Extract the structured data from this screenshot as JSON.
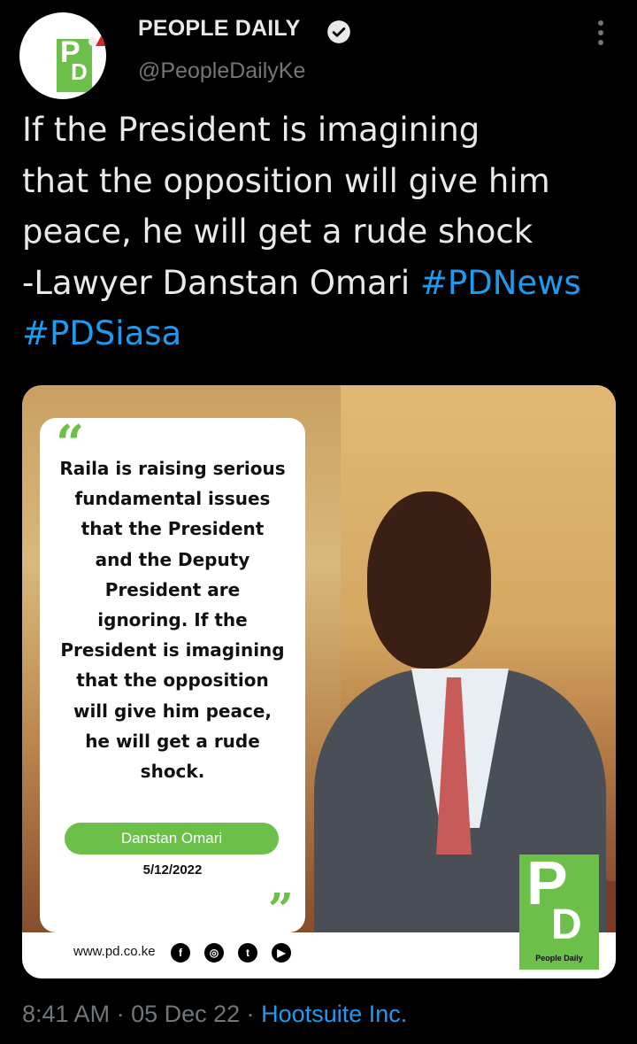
{
  "account": {
    "name": "PEOPLE DAILY",
    "handle": "@PeopleDailyKe",
    "avatar_label": "People Daily"
  },
  "tweet": {
    "lines": [
      "If the President is imagining",
      "that the opposition will give him",
      "peace, he will get a rude shock",
      "-Lawyer Danstan Omari "
    ],
    "hashtag1": "#PDNews",
    "hashtag2": "#PDSiasa"
  },
  "media": {
    "quote_lines": [
      "Raila is raising serious",
      "fundamental issues",
      "that the President",
      "and the Deputy",
      "President are",
      "ignoring. If the",
      "President is imagining",
      "that the opposition",
      "will give him peace,",
      "he will get a rude",
      "shock."
    ],
    "speaker": "Danstan Omari",
    "date": "5/12/2022",
    "website": "www.pd.co.ke",
    "brand": "People Daily",
    "social": [
      "f",
      "◎",
      "t",
      "▶"
    ]
  },
  "meta": {
    "time": "8:41 AM",
    "sep1": " · ",
    "date": "05 Dec 22",
    "sep2": " · ",
    "source": "Hootsuite Inc."
  },
  "colors": {
    "background": "#000000",
    "text": "#e7e9ea",
    "secondary": "#71767b",
    "link": "#1d9bf0",
    "brand_green": "#6cc04a"
  }
}
